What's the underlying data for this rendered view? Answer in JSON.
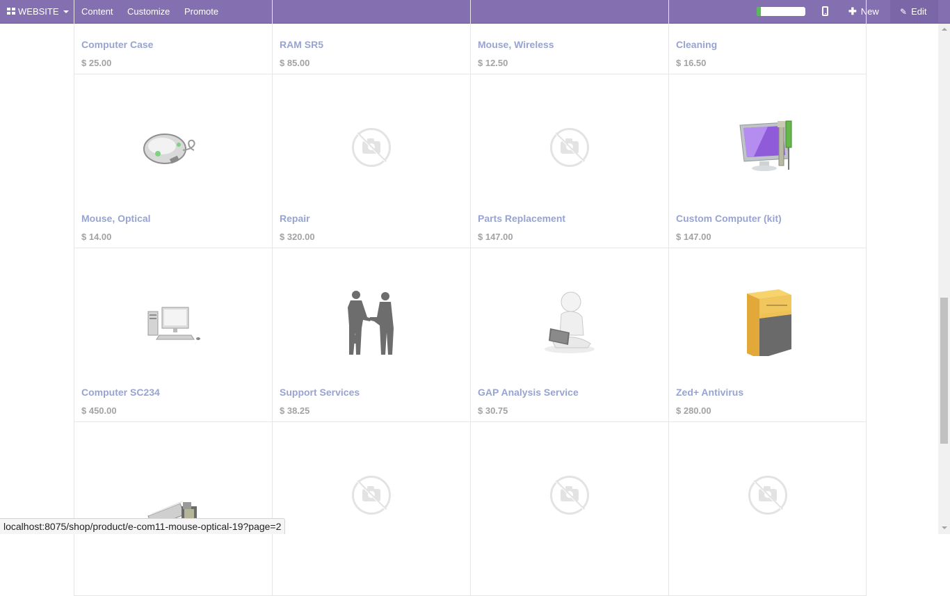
{
  "topbar": {
    "website_label": "WEBSITE",
    "content_label": "Content",
    "customize_label": "Customize",
    "promote_label": "Promote",
    "progress_fraction": 0.08,
    "new_label": "New",
    "edit_label": "Edit",
    "icons": [
      "apps-grid-icon",
      "caret-down-icon",
      "mobile-phone-icon",
      "plus-icon",
      "pencil-icon"
    ]
  },
  "products": [
    {
      "name": "Computer Case",
      "price": "$ 25.00",
      "image": "none"
    },
    {
      "name": "RAM SR5",
      "price": "$ 85.00",
      "image": "none"
    },
    {
      "name": "Mouse, Wireless",
      "price": "$ 12.50",
      "image": "none"
    },
    {
      "name": "Cleaning",
      "price": "$ 16.50",
      "image": "none"
    },
    {
      "name": "Mouse, Optical",
      "price": "$ 14.00",
      "image": "mouse-image"
    },
    {
      "name": "Repair",
      "price": "$ 320.00",
      "image": "placeholder"
    },
    {
      "name": "Parts Replacement",
      "price": "$ 147.00",
      "image": "placeholder"
    },
    {
      "name": "Custom Computer (kit)",
      "price": "$ 147.00",
      "image": "computer-kit-image"
    },
    {
      "name": "Computer SC234",
      "price": "$ 450.00",
      "image": "desktop-computer-image"
    },
    {
      "name": "Support Services",
      "price": "$ 38.25",
      "image": "handshake-image"
    },
    {
      "name": "GAP Analysis Service",
      "price": "$ 30.75",
      "image": "laptop-figure-image"
    },
    {
      "name": "Zed+ Antivirus",
      "price": "$ 280.00",
      "image": "software-box-image"
    },
    {
      "name": "",
      "price": "",
      "image": "usb-drive-image"
    },
    {
      "name": "",
      "price": "",
      "image": "placeholder"
    },
    {
      "name": "",
      "price": "",
      "image": "placeholder"
    },
    {
      "name": "",
      "price": "",
      "image": "placeholder"
    }
  ],
  "statusbar": {
    "url": "localhost:8075/shop/product/e-com11-mouse-optical-19?page=2"
  }
}
